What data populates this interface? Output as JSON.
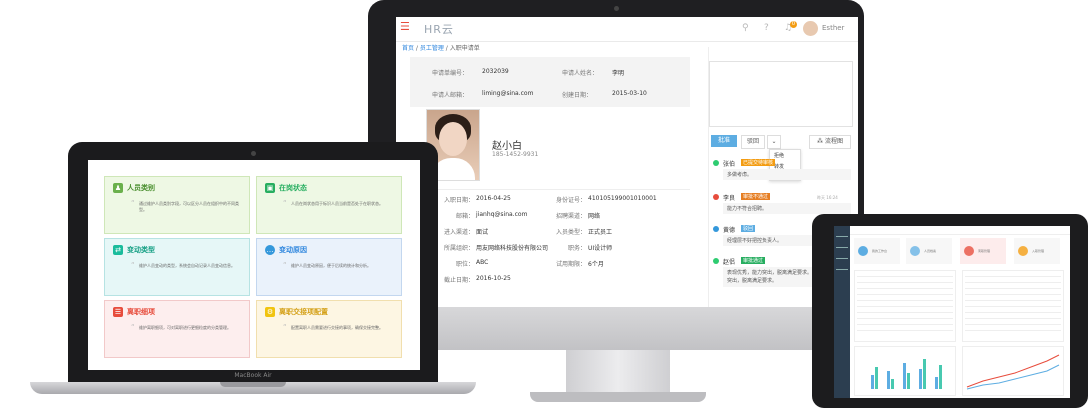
{
  "imac": {
    "logo": "HR云",
    "username": "Esther",
    "notification_count": "0",
    "breadcrumb": {
      "home": "首页",
      "section": "员工管理",
      "current": "入职申请单"
    },
    "info": {
      "app_no_label": "申请单编号：",
      "app_no": "2032039",
      "applicant_label": "申请人姓名：",
      "applicant": "李明",
      "email_label": "申请人邮箱：",
      "email": "liming@sina.com",
      "created_label": "创建日期：",
      "created": "2015-03-10"
    },
    "person": {
      "name": "赵小白",
      "phone": "185-1452-9931",
      "fields": [
        {
          "l": "入职日期：",
          "v": "2016-04-25",
          "l2": "身份证号：",
          "v2": "410105199001010001"
        },
        {
          "l": "邮箱：",
          "v": "jianhq@sina.com",
          "l2": "招聘渠道：",
          "v2": "网络"
        },
        {
          "l": "进入渠道：",
          "v": "面试",
          "l2": "入员类型：",
          "v2": "正式员工"
        },
        {
          "l": "所属组织：",
          "v": "用友网络科技股份有限公司",
          "l2": "职务：",
          "v2": "UI设计师"
        },
        {
          "l": "职位：",
          "v": "ABC",
          "l2": "试用期限：",
          "v2": "6个月"
        },
        {
          "l": "截止日期：",
          "v": "2016-10-25",
          "l2": "",
          "v2": ""
        }
      ]
    },
    "actions": {
      "approve": "批准",
      "reject": "驳回",
      "flow": "流程图"
    },
    "dropdown": [
      "拒绝",
      "转发"
    ],
    "timeline": [
      {
        "name": "张伯",
        "tag": "已提交待审核",
        "text": "多做考虑。",
        "time": ""
      },
      {
        "name": "李良",
        "tag": "审批不通过",
        "text": "能力不符合招聘。",
        "time": "昨天 16:24"
      },
      {
        "name": "黄德",
        "tag": "驳回",
        "text": "经理层不好把控负责人。",
        "time": "昨天 10:52"
      },
      {
        "name": "赵侣",
        "tag": "审批通过",
        "text": "表现优秀，能力突出，脱离满足要求。表现优秀，能力突出，脱离满足要求。",
        "time": ""
      }
    ]
  },
  "macbook": {
    "label": "MacBook Air",
    "cards": [
      {
        "title": "人员类别",
        "text": "通过维护人员类别字段，可以区分人员在组织中的不同类型。"
      },
      {
        "title": "在岗状态",
        "text": "人员在岗状态用于标识人员当前是否处于在职状态。"
      },
      {
        "title": "变动类型",
        "text": "维护人员变动的类型，系统会自动记录人员变动信息。"
      },
      {
        "title": "变动原因",
        "text": "维护人员变动原因，便于后续的统计和分析。"
      },
      {
        "title": "离职细项",
        "text": "维护离职细项，可对离职进行更细粒度的分类管理。"
      },
      {
        "title": "离职交接项配置",
        "text": "配置离职人员需要进行交接的事项，确保交接完整。"
      }
    ]
  },
  "tablet": {
    "quick": [
      "我的工作台",
      "人员档案",
      "离职管理",
      "入职管理"
    ]
  }
}
